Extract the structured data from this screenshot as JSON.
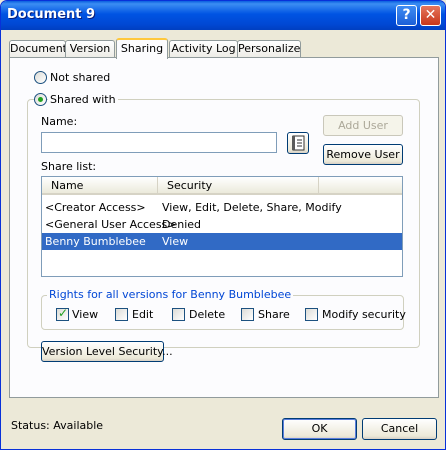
{
  "window": {
    "title": "Document 9"
  },
  "title_buttons": {
    "help": "?",
    "close": "✕"
  },
  "tabs": [
    {
      "label": "Document"
    },
    {
      "label": "Version"
    },
    {
      "label": "Sharing"
    },
    {
      "label": "Activity Log"
    },
    {
      "label": "Personalize"
    }
  ],
  "active_tab": "Sharing",
  "sharing": {
    "not_shared_label": "Not shared",
    "shared_with_label": "Shared with",
    "selected_option": "Shared with",
    "name_label": "Name:",
    "name_value": "",
    "address_book_icon": "address-book-icon",
    "add_user_label": "Add User",
    "remove_user_label": "Remove User",
    "share_list_label": "Share list:",
    "columns": [
      "Name",
      "Security"
    ],
    "rows": [
      {
        "name": "<Creator Access>",
        "security": "View, Edit, Delete, Share, Modify"
      },
      {
        "name": "<General User Access>",
        "security": "Denied"
      },
      {
        "name": "Benny Bumblebee",
        "security": "View",
        "selected": true
      }
    ],
    "rights_group_label": "Rights for all versions for Benny Bumblebee",
    "rights": [
      {
        "label": "View",
        "checked": true
      },
      {
        "label": "Edit",
        "checked": false
      },
      {
        "label": "Delete",
        "checked": false
      },
      {
        "label": "Share",
        "checked": false
      },
      {
        "label": "Modify security",
        "checked": false
      }
    ],
    "version_security_label": "Version Level Security..."
  },
  "footer": {
    "status": "Status: Available",
    "ok_label": "OK",
    "cancel_label": "Cancel"
  },
  "colors": {
    "title_bar": "#0054e3",
    "selection": "#316ac5",
    "group_label": "#0046d5",
    "face": "#ece9d8"
  }
}
